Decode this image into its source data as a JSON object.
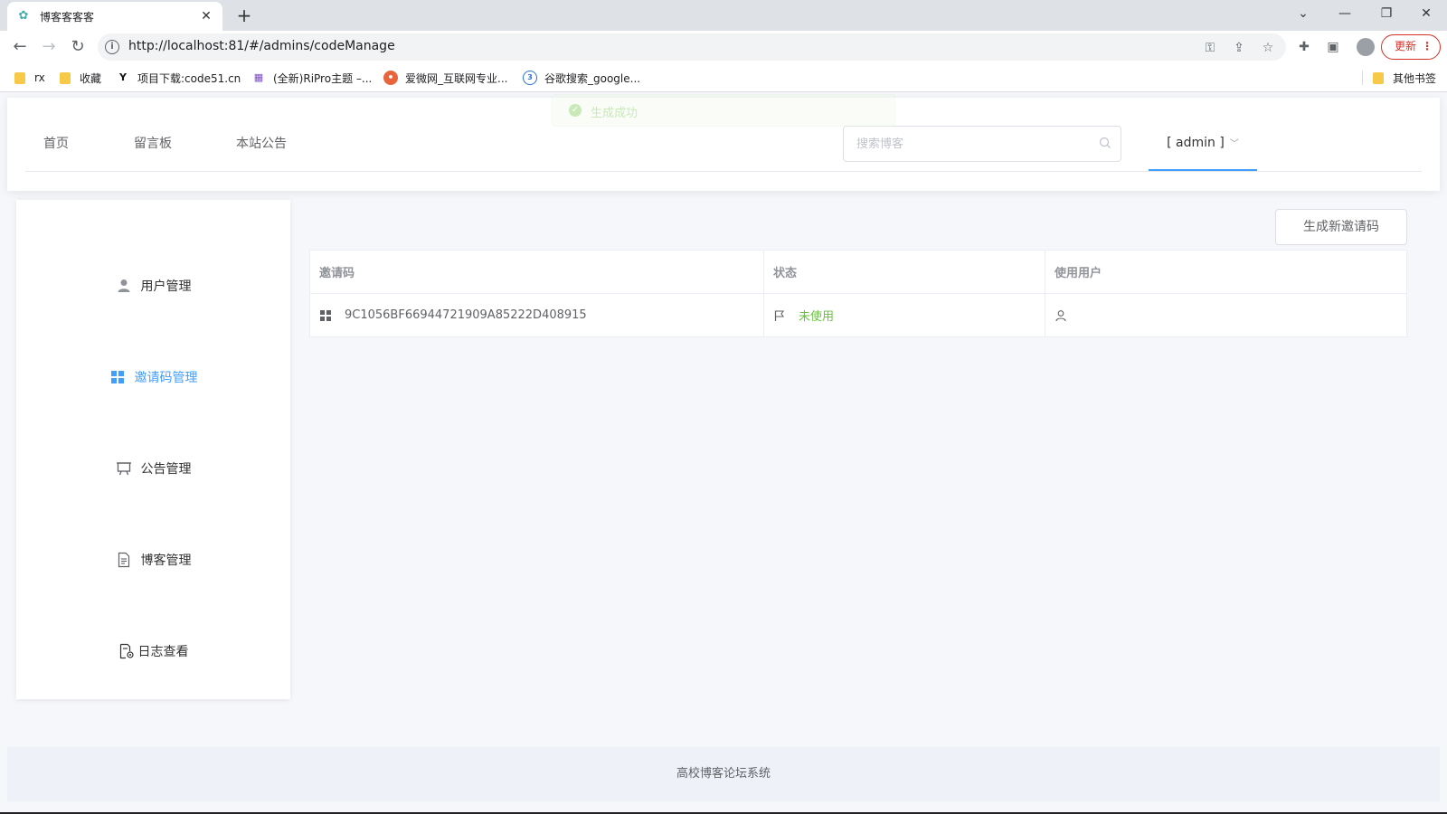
{
  "browser": {
    "tab_title": "博客客客客",
    "url": "http://localhost:81/#/admins/codeManage",
    "update_label": "更新",
    "bookmarks": [
      {
        "label": "rx"
      },
      {
        "label": "收藏"
      },
      {
        "label": "项目下载:code51.cn"
      },
      {
        "label": "(全新)RiPro主题 –..."
      },
      {
        "label": "爱微网_互联网专业..."
      },
      {
        "label": "谷歌搜索_google..."
      }
    ],
    "other_bookmarks": "其他书签"
  },
  "toast": {
    "message": "生成成功"
  },
  "header": {
    "nav": [
      {
        "label": "首页"
      },
      {
        "label": "留言板"
      },
      {
        "label": "本站公告"
      }
    ],
    "search_placeholder": "搜索博客",
    "user_label": "[  admin  ]"
  },
  "sidebar": {
    "items": [
      {
        "label": "用户管理",
        "icon": "user-icon"
      },
      {
        "label": "邀请码管理",
        "icon": "grid-icon"
      },
      {
        "label": "公告管理",
        "icon": "board-icon"
      },
      {
        "label": "博客管理",
        "icon": "document-icon"
      },
      {
        "label": "日志查看",
        "icon": "log-icon"
      }
    ],
    "active_index": 1
  },
  "main": {
    "generate_button": "生成新邀请码",
    "table": {
      "columns": [
        "邀请码",
        "状态",
        "使用用户"
      ],
      "rows": [
        {
          "code": "9C1056BF66944721909A85222D408915",
          "status": "未使用",
          "user": ""
        }
      ]
    }
  },
  "footer": {
    "text": "高校博客论坛系统"
  },
  "colors": {
    "accent": "#409eff",
    "success": "#67c23a",
    "update": "#d93025"
  }
}
